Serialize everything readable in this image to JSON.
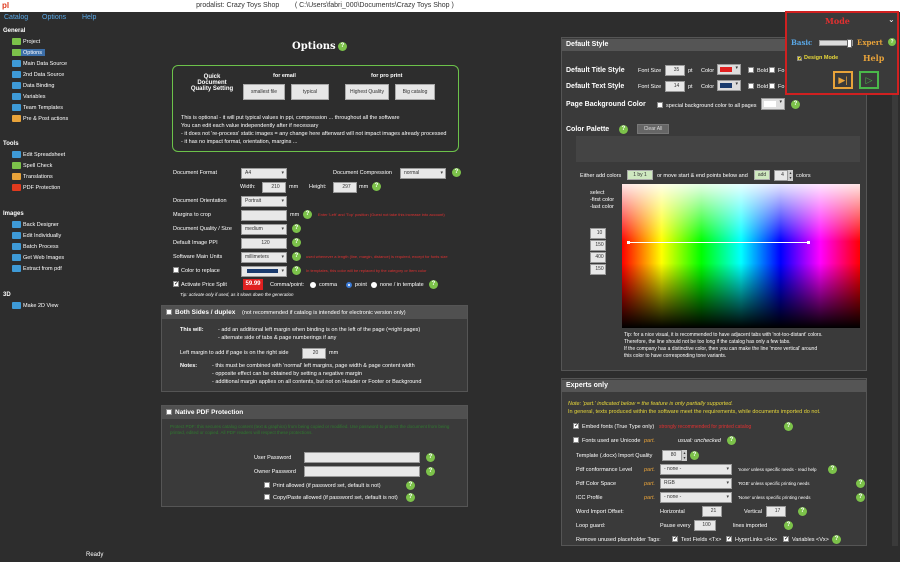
{
  "window": {
    "title": "prodalist: Crazy Toys Shop        ( C:\\Users\\fabri_000\\Documents\\Crazy Toys Shop )",
    "logo": "pl"
  },
  "menu": [
    "Catalog",
    "Options",
    "Help"
  ],
  "sidebar": {
    "general": "General",
    "general_items": [
      "Project",
      "Options",
      "Main Data Source",
      "2nd Data Source",
      "Data Binding",
      "Variables",
      "Team Templates",
      "Pre & Post actions"
    ],
    "tools": "Tools",
    "tools_items": [
      "Edit Spreadsheet",
      "Spell Check",
      "Translations",
      "PDF Protection"
    ],
    "images": "Images",
    "images_items": [
      "Back Designer",
      "Edit Individually",
      "Batch Process",
      "Get Web Images",
      "Extract from pdf"
    ],
    "d3": "3D",
    "d3_items": [
      "Make 2D View"
    ]
  },
  "status": "Ready",
  "options": {
    "title": "Options",
    "quick": "Quick Document Quality Setting",
    "for_email": "for email",
    "for_pro": "for pro print",
    "btn_small": "smallest file",
    "btn_typical": "typical",
    "btn_high": "Highest Quality",
    "btn_big": "Big catalog",
    "info": [
      "This is optional - it will put typical values in ppi, compression ... throughout all the software",
      "You can edit each value independently after if necessary",
      "- it does not 're-process' static images = any change here afterward will not impact images already processed",
      "- it has no impact format, orientation, margins ..."
    ],
    "doc_format_lbl": "Document Format",
    "doc_format": "A4",
    "doc_comp_lbl": "Document Compression",
    "doc_comp": "normal",
    "width_lbl": "Width:",
    "width": "210",
    "mm": "mm",
    "height_lbl": "Height:",
    "height": "297",
    "orient_lbl": "Document Orientation",
    "orient": "Portrait",
    "margins_lbl": "Margins to crop",
    "margins_note": "Enter 'Left' and 'Top' position (Guest not take this increase into account)",
    "quality_lbl": "Document Quality / Size",
    "quality": "medium",
    "ppi_lbl": "Default Image PPI",
    "ppi": "120",
    "units_lbl": "Software Main Units",
    "units": "millimeters",
    "units_note": "used whenever a length (line, margin, distance) is required, except for fonts size",
    "color_lbl": "Color to replace",
    "color_note": "In templates, this color will be replaced by the category or Item color",
    "split_lbl": "Activate Price Split",
    "split_tip": "Tip: activate only if used, as it slows down the generation",
    "split_sample": "59.99",
    "comma_lbl": "Comma/point:",
    "comma": "comma",
    "point": "point",
    "none": "none / in template"
  },
  "both": {
    "title": "Both Sides / duplex",
    "note": "(not recommended if catalog is intended for electronic version only)",
    "will": "This will:",
    "will1": "- add an additional left margin when binding is on the left of the page (=right pages)",
    "will2": "- alternate side of tabs & page numberings if any",
    "left_lbl": "Left margin to add if page is on the right side",
    "left": "20",
    "mm": "mm",
    "notes": "Notes:",
    "n1": "- this must be combined with 'normal' left margins, page width & page  content width",
    "n2": "- opposite effect can be obtained by setting a negative margin",
    "n3": "- additional margin applies on all contents, but not on Header or Footer or Background"
  },
  "pdf": {
    "title": "Native PDF Protection",
    "desc": "Protect PDF: this secures catalog content (text & graphics) from being copied or modified. Use password to protect the document from being printed, edited or copied. All PDF readers will respect these protections.",
    "user": "User Password",
    "owner": "Owner Password",
    "print": "Print allowed (if password set, default is not)",
    "copy": "Copy/Paste allowed (if password set, default is not)"
  },
  "style": {
    "hdr": "Default Style",
    "title_style": "Default Title Style",
    "text_style": "Default Text Style",
    "font_size": "Font Size",
    "title_size": "35",
    "text_size": "14",
    "pt": "pt",
    "color": "Color",
    "bold": "Bold",
    "fo": "Fo",
    "bg": "Page Background Color",
    "bg_special": "special background color to all pages",
    "palette": "Color Palette",
    "clear": "Clear All",
    "either": "Either add colors",
    "one_by_one": "1 by 1",
    "or_move": "or move start & end points below and",
    "add": "add",
    "count": "4",
    "colors": "colors",
    "select": "select",
    "first": "-first color",
    "last": "-last color",
    "vals": [
      "10",
      "150",
      "400",
      "150"
    ],
    "tip": [
      "Tip: for a nice visual, it is recommended to have adjacent tabs with 'not-too-distant' colors.",
      "Therefore, the line should not be too long if the catalog has only a few tabs.",
      "If the company has a distinctive color, then you can make the line 'more vertical' around",
      "this color to have corresponding tone variants."
    ]
  },
  "experts": {
    "hdr": "Experts only",
    "note1": "Note: 'part.' indicated below = the feature is only partially supported.",
    "note2": "In general, texts produced within the software meet the requirements, while documents imported do not.",
    "embed": "Embed fonts (True Type only)",
    "embed_note": "strongly recommended for printed catalog",
    "unicode": "Fonts used are Unicode",
    "part": "part.",
    "usual": "usual: unchecked",
    "tpl": "Template (.docx) Import Quality",
    "tpl_val": "80",
    "pdf_conf": "Pdf conformance Level",
    "none_opt": "- none -",
    "pdf_note": "'none' unless specific needs - read help",
    "space": "Pdf Color Space",
    "space_val": "RGB",
    "space_note": "'RGB' unless specific printing needs",
    "icc": "ICC Profile",
    "icc_note": "'None' unless specific printing needs",
    "offset": "Word Import Offset:",
    "horiz": "Horizontal",
    "horiz_val": "21",
    "vert": "Vertical",
    "vert_val": "17",
    "loop": "Loop guard:",
    "pause": "Pause every",
    "pause_val": "100",
    "lines": "lines imported",
    "remove": "Remove unused placeholder Tags:",
    "tf": "Text Fields <Tx>",
    "hl": "HyperLinks <Hx>",
    "vars": "Variables <Vx>"
  },
  "mode": {
    "title": "Mode",
    "basic": "Basic",
    "expert": "Expert",
    "design": "Design Mode",
    "help": "Help"
  }
}
